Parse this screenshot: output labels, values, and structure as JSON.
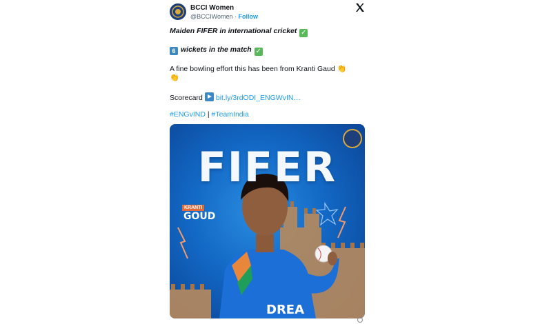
{
  "account": {
    "name": "BCCI Women",
    "handle": "@BCCIWomen",
    "separator": "·",
    "follow_label": "Follow"
  },
  "tweet": {
    "line1": "Maiden FIFER in international cricket",
    "line2_keycap": "6",
    "line2": "wickets in the match",
    "line3": "A fine bowling effort this has been from Kranti Gaud",
    "scorecard_label": "Scorecard",
    "scorecard_link": "bit.ly/3rdODI_ENGWvIN…",
    "hashtag1": "#ENGvIND",
    "hashtag_sep": "|",
    "hashtag2": "#TeamIndia"
  },
  "media": {
    "headline": "FIFER",
    "player_first": "KRANTI",
    "player_last": "GOUD"
  },
  "colors": {
    "link": "#1d9bf0",
    "poster_blue": "#1268c4",
    "check_green": "#59b85a"
  }
}
